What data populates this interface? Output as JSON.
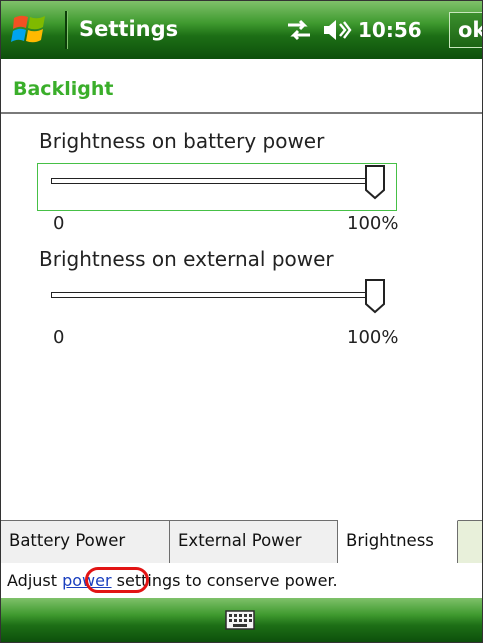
{
  "titlebar": {
    "app_title": "Settings",
    "clock": "10:56",
    "ok_label": "ok",
    "icons": [
      "windows-start-icon",
      "connectivity-icon",
      "volume-icon"
    ]
  },
  "section": {
    "title": "Backlight"
  },
  "battery": {
    "label": "Brightness on battery power",
    "min": "0",
    "max": "100%",
    "value_percent": 100
  },
  "external": {
    "label": "Brightness on external power",
    "min": "0",
    "max": "100%",
    "value_percent": 100
  },
  "tabs": [
    {
      "label": "Battery Power",
      "active": false
    },
    {
      "label": "External Power",
      "active": false
    },
    {
      "label": "Brightness",
      "active": true
    }
  ],
  "help": {
    "prefix": "Adjust ",
    "link": "power",
    "suffix": " settings to conserve power."
  },
  "bottombar": {
    "icon": "keyboard-icon"
  },
  "colors": {
    "accent_green": "#3aae2a",
    "bar_green": "#1d6f16",
    "link_blue": "#1a3fbf",
    "highlight_red": "#e21414"
  }
}
